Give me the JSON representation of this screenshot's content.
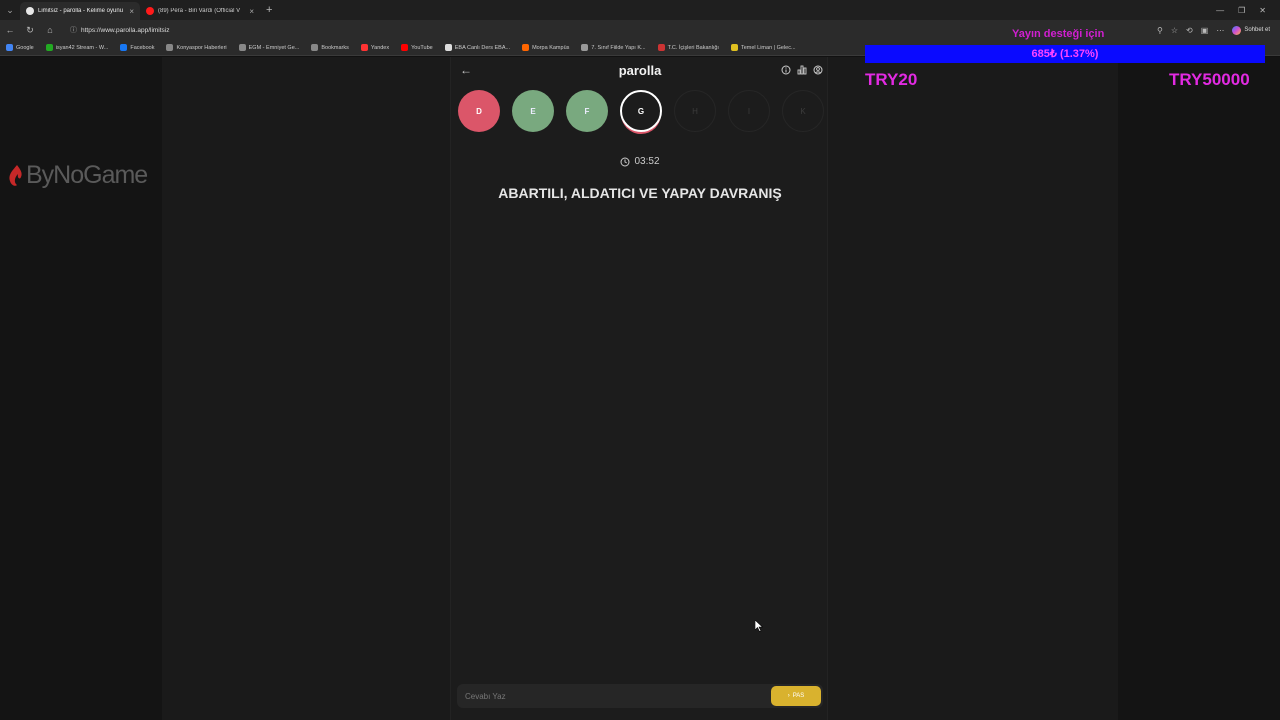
{
  "tabs": [
    {
      "title": "Limitsiz - parolla - Kelime oyunu",
      "active": true,
      "favicon_color": "#e8e8e8"
    },
    {
      "title": "(89) Pera - Biri Vardı (Official V",
      "active": false,
      "favicon_color": "#ff1a1a"
    }
  ],
  "address_bar": {
    "url": "https://www.parolla.app/limitsiz"
  },
  "toolbar": {
    "chat_label": "Sohbet et"
  },
  "bookmarks": [
    {
      "label": "Google",
      "color": "#4285f4"
    },
    {
      "label": "isyan42 Stream - W...",
      "color": "#22aa22"
    },
    {
      "label": "Facebook",
      "color": "#1877f2"
    },
    {
      "label": "Konyaspor Haberleri",
      "color": "#888888"
    },
    {
      "label": "EGM - Emniyet Ge...",
      "color": "#888888"
    },
    {
      "label": "Bookmarks",
      "color": "#888888"
    },
    {
      "label": "Yandex",
      "color": "#ff3333"
    },
    {
      "label": "YouTube",
      "color": "#ff0000"
    },
    {
      "label": "EBA Canlı Ders EBA...",
      "color": "#dddddd"
    },
    {
      "label": "Morpa Kampüs",
      "color": "#ff6600"
    },
    {
      "label": "7. Sınıf Fiilde Yapı K...",
      "color": "#999999"
    },
    {
      "label": "T.C. İçişleri Bakanlığı",
      "color": "#cc3333"
    },
    {
      "label": "Temel Liman | Gelec...",
      "color": "#e0c020"
    }
  ],
  "logo": {
    "text": "ByNoGame"
  },
  "app": {
    "brand": "parolla",
    "timer": "03:52",
    "question": "ABARTILI, ALDATICI VE YAPAY DAVRANIŞ",
    "letters": [
      {
        "letter": "D",
        "state": "wrong"
      },
      {
        "letter": "E",
        "state": "right"
      },
      {
        "letter": "F",
        "state": "right"
      },
      {
        "letter": "G",
        "state": "current"
      },
      {
        "letter": "H",
        "state": "pending"
      },
      {
        "letter": "I",
        "state": "pending"
      },
      {
        "letter": "K",
        "state": "pending"
      }
    ],
    "answer_placeholder": "Cevabı Yaz",
    "pass_label": "PAS"
  },
  "overlay": {
    "title": "Yayın desteği için",
    "progress_text": "685₺ (1.37%)",
    "progress_value": 0.0137,
    "goal_min": "TRY20",
    "goal_max": "TRY50000"
  }
}
